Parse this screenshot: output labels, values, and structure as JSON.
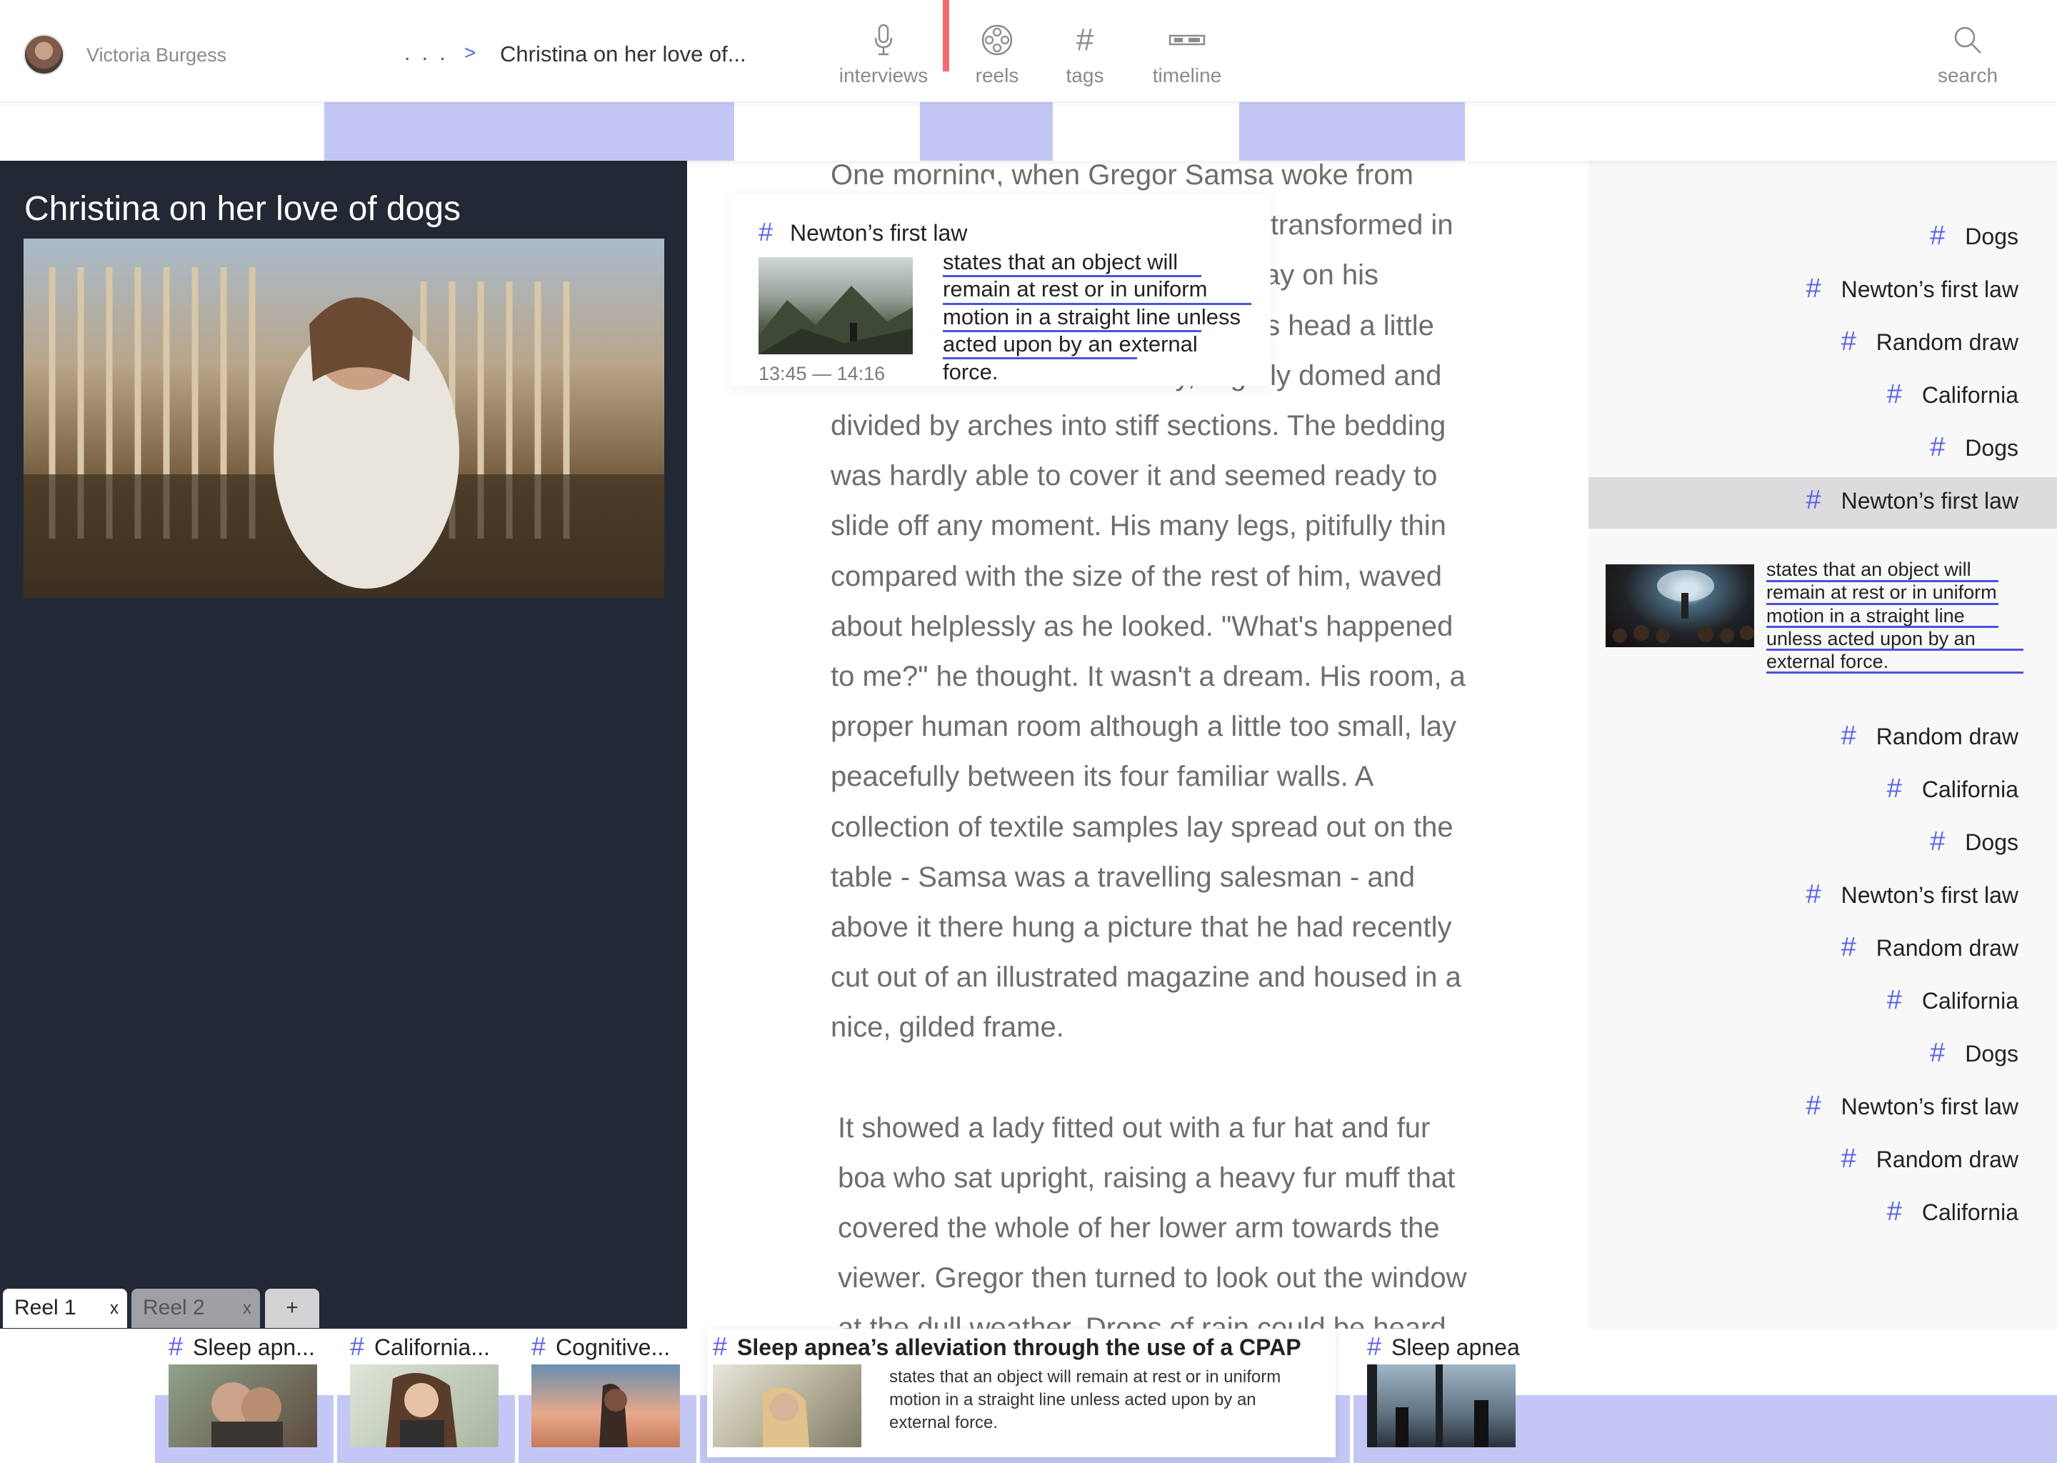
{
  "header": {
    "user_name": "Victoria Burgess",
    "breadcrumb_ellipsis": ". . .",
    "breadcrumb_separator": ">",
    "breadcrumb_current": "Christina on her love of...",
    "nav": [
      {
        "label": "interviews",
        "icon": "microphone-icon"
      },
      {
        "label": "reels",
        "icon": "film-reel-icon"
      },
      {
        "label": "tags",
        "icon": "hash-icon"
      },
      {
        "label": "timeline",
        "icon": "timeline-icon"
      }
    ],
    "search_label": "search"
  },
  "clip": {
    "title": "Christina on her love of dogs"
  },
  "reel_tabs": [
    {
      "label": "Reel 1",
      "close": "x",
      "active": true
    },
    {
      "label": "Reel 2",
      "close": "x",
      "active": false
    }
  ],
  "add_reel_label": "+",
  "transcript": {
    "paragraphs": [
      "One morning, when Gregor Samsa woke from troubled dreams, he found himself transformed in his bed into a horrible vermin. He lay on his armour-like back, and if he lifted his head a little he could see his brown belly, slightly domed and divided by arches into stiff sections. The bedding was hardly able to cover it and seemed ready to slide off any moment. His many legs, pitifully thin compared with the size of the rest of him, waved about helplessly as he looked. \"What's happened to me?\" he thought. It wasn't a dream. His room, a proper human room although a little too small, lay peacefully between its four familiar walls. A collection of textile samples lay spread out on the table - Samsa was a travelling salesman - and above it there hung a picture that he had recently cut out of an illustrated magazine and housed in a nice, gilded frame.",
      "It showed a lady fitted out with a fur hat and fur boa who sat upright, raising a heavy fur muff that covered the whole of her lower arm towards the viewer. Gregor then turned to look out the window at the dull weather. Drops of rain could be heard"
    ]
  },
  "popup": {
    "tag": "Newton’s first law",
    "time": "13:45 — 14:16",
    "text": "states that an object will remain at rest or in uniform motion in a straight line unless acted upon by an external force."
  },
  "right_tags": [
    "Dogs",
    "Newton’s first law",
    "Random draw",
    "California",
    "Dogs",
    "Newton’s first law",
    "Random draw",
    "California",
    "Dogs",
    "Newton’s first law",
    "Random draw",
    "California",
    "Dogs",
    "Newton’s first law",
    "Random draw",
    "California"
  ],
  "right_expanded_text": "states that an object will remain at rest or in uniform motion in a straight line unless acted upon by an external force.",
  "bottom_clips": [
    {
      "label": "Sleep apn..."
    },
    {
      "label": "California..."
    },
    {
      "label": "Cognitive..."
    },
    {
      "label": "Sleep apnea’s alleviation through the use of a CPAP",
      "desc": "states that an object will remain at rest or in uniform motion in a straight line unless acted upon by an external force."
    },
    {
      "label": "Sleep apnea"
    }
  ],
  "colors": {
    "accent": "#5b63e6",
    "timeline_fill": "#c4c7f6",
    "dark_panel": "#222834",
    "playhead": "#f06d6d"
  }
}
